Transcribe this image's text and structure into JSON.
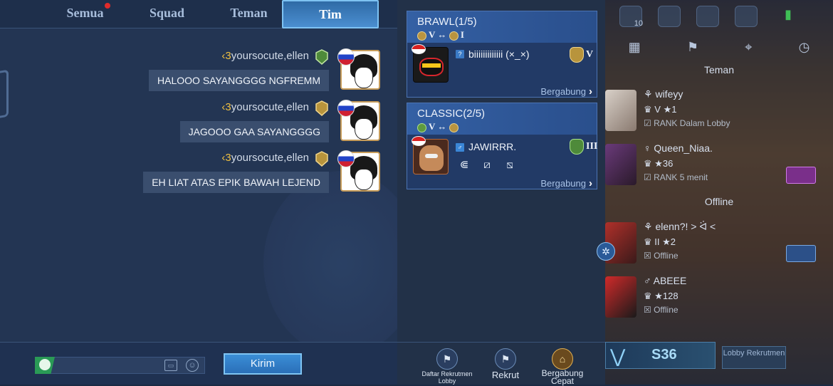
{
  "chat": {
    "tabs": [
      {
        "label": "Semua",
        "has_notification": true
      },
      {
        "label": "Squad"
      },
      {
        "label": "Teman"
      },
      {
        "label": "Tim",
        "active": true
      }
    ],
    "messages": [
      {
        "sender_prefix": "‹3",
        "sender": "yoursocute,ellen",
        "text": "HALOOO SAYANGGGG NGFREMM"
      },
      {
        "sender_prefix": "‹3",
        "sender": "yoursocute,ellen",
        "text": "JAGOOO GAA SAYANGGGG"
      },
      {
        "sender_prefix": "‹3",
        "sender": "yoursocute,ellen",
        "text": "EH LIAT ATAS EPIK BAWAH LEJEND"
      }
    ],
    "input_value": "",
    "send_label": "Kirim"
  },
  "lobbies": [
    {
      "title": "BRAWL(1/5)",
      "rank_from": "V",
      "rank_arrow": "↔",
      "rank_to": "I",
      "player_name": "biiiiiiiiiiiii (×_×)",
      "player_rank": "V",
      "join_label": "Bergabung"
    },
    {
      "title": "CLASSIC(2/5)",
      "rank_from": "V",
      "rank_arrow": "↔",
      "rank_to": "",
      "player_name": "JAWIRRR.",
      "player_rank": "III",
      "join_label": "Bergabung"
    }
  ],
  "lobby_footer": {
    "recruit_list_label": "Daftar Rekrutmen Lobby",
    "recruit_label": "Rekrut",
    "quick_join_label": "Bergabung Cepat"
  },
  "friends": {
    "top_badge": "10",
    "section_friends": "Teman",
    "section_offline": "Offline",
    "rows": [
      {
        "name": "wifeyy",
        "rank": "V",
        "stars": "1",
        "status": "RANK Dalam Lobby"
      },
      {
        "name": "Queen_Niaa.",
        "rank": "",
        "stars": "36",
        "status": "RANK 5 menit"
      },
      {
        "name": "elenn?! > ᐛ <",
        "rank": "II",
        "stars": "2",
        "status": "Offline"
      },
      {
        "name": "ABEEE",
        "rank": "",
        "stars": "128",
        "status": "Offline"
      }
    ],
    "season": "S36",
    "lobby_recruit_label": "Lobby Rekrutmen"
  },
  "colors": {
    "accent": "#4b8ed0",
    "panel": "#233553",
    "card": "#2c4b84",
    "online_green": "#3fbf56"
  }
}
